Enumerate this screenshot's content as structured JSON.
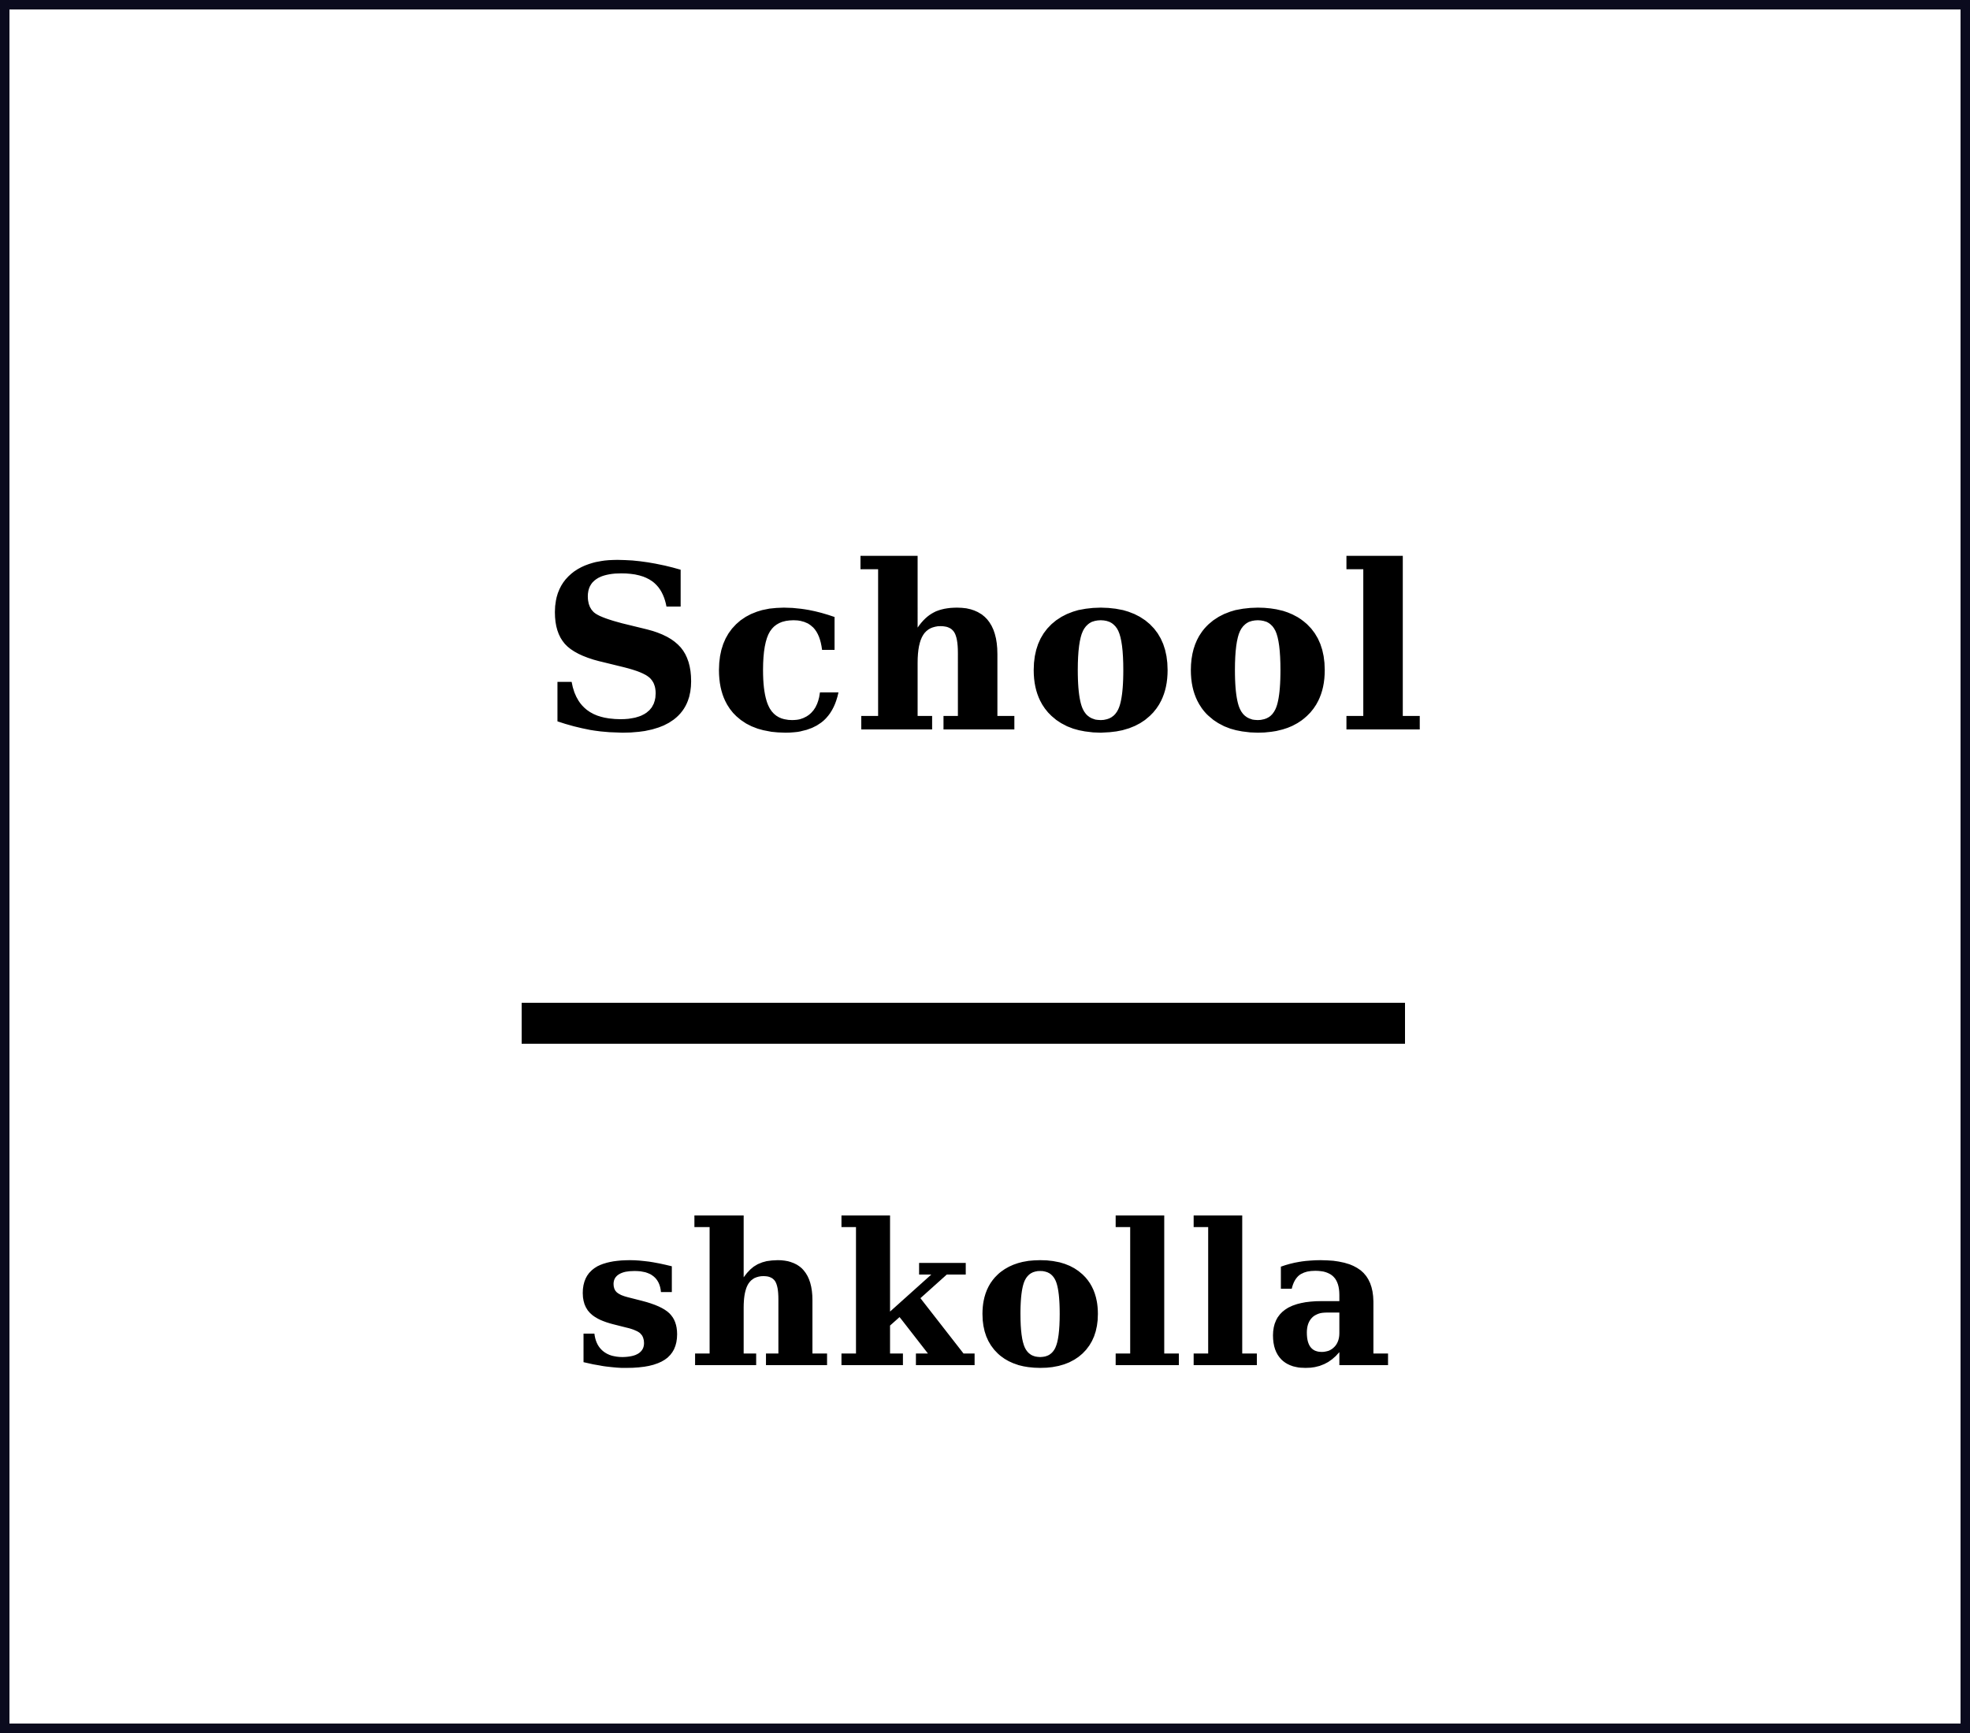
{
  "card": {
    "english_word": "School",
    "translation": "shkolla"
  },
  "colors": {
    "border": "#0b0b1e",
    "background": "#ffffff",
    "text": "#000000",
    "divider": "#000000"
  }
}
